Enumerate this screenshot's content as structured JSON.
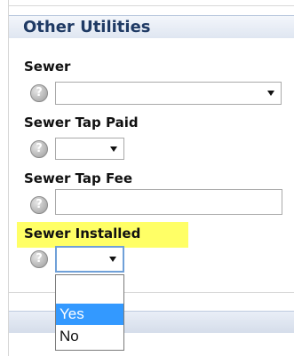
{
  "section": {
    "title": "Other Utilities"
  },
  "fields": {
    "sewer": {
      "label": "Sewer",
      "value": ""
    },
    "sewer_tap_paid": {
      "label": "Sewer Tap Paid",
      "value": ""
    },
    "sewer_tap_fee": {
      "label": "Sewer Tap Fee",
      "value": ""
    },
    "sewer_installed": {
      "label": "Sewer Installed",
      "value": ""
    }
  },
  "help_icon_glyph": "?",
  "dropdown": {
    "options": [
      "Yes",
      "No"
    ],
    "highlighted": "Yes"
  },
  "icons": {
    "help": "question-mark-help-icon",
    "arrow": "chevron-down-icon"
  },
  "colors": {
    "highlight": "#ffff66",
    "selected_option": "#3399ff",
    "header_text": "#1f3a64"
  }
}
